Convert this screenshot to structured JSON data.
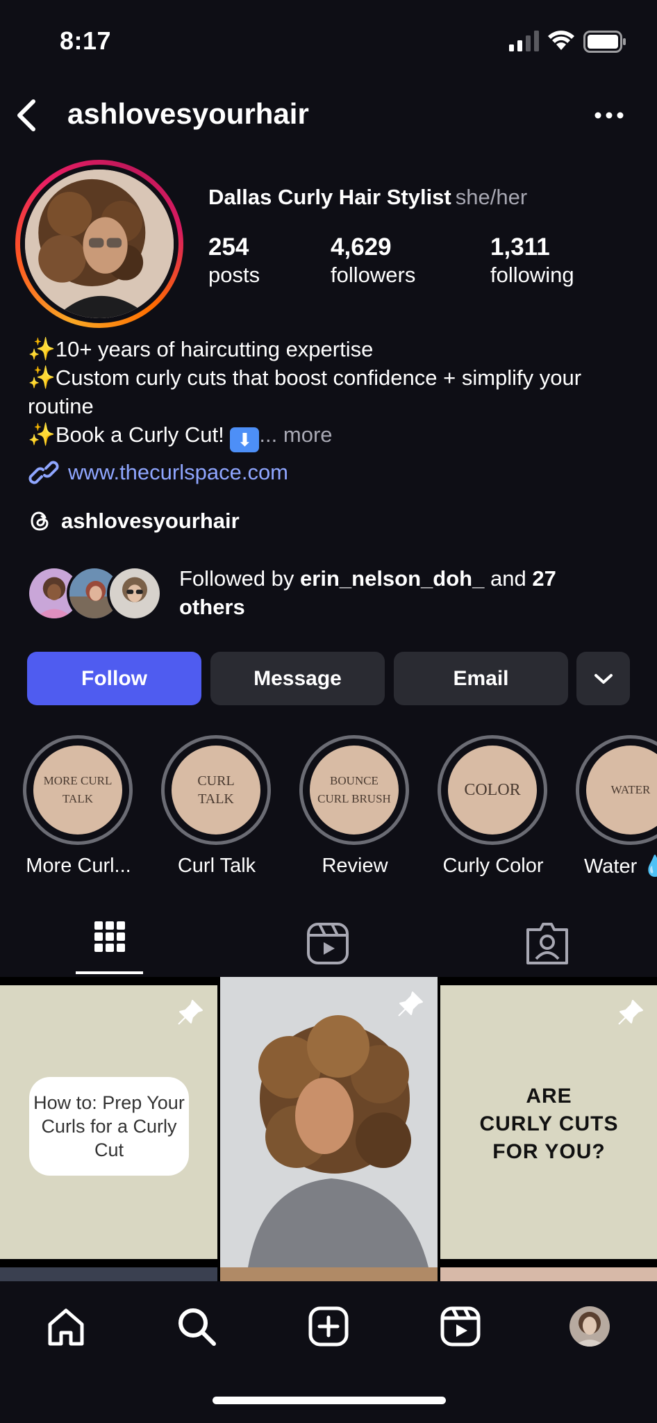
{
  "status_bar": {
    "time": "8:17"
  },
  "header": {
    "username": "ashlovesyourhair"
  },
  "profile": {
    "display_name": "Dallas Curly Hair Stylist",
    "pronouns": "she/her",
    "stats": {
      "posts": {
        "value": "254",
        "label": "posts"
      },
      "followers": {
        "value": "4,629",
        "label": "followers"
      },
      "following": {
        "value": "1,311",
        "label": "following"
      }
    },
    "bio": {
      "line1": "10+ years of haircutting expertise",
      "line2": "Custom curly cuts that boost confidence + simplify your routine",
      "line3": "Book a Curly Cut!",
      "ellipsis": "...",
      "more": "more"
    },
    "website": "www.thecurlspace.com",
    "threads_handle": "ashlovesyourhair",
    "followed_by": {
      "prefix": "Followed by",
      "user": "erin_nelson_doh_",
      "middle": "and",
      "count": "27 others"
    }
  },
  "actions": {
    "follow": "Follow",
    "message": "Message",
    "email": "Email"
  },
  "highlights": [
    {
      "cover": "MORE CURL TALK",
      "label": "More Curl..."
    },
    {
      "cover": "CURL TALK",
      "label": "Curl Talk"
    },
    {
      "cover": "BOUNCE CURL BRUSH",
      "label": "Review"
    },
    {
      "cover": "COLOR",
      "label": "Curly Color"
    },
    {
      "cover": "WATER",
      "label": "Water 💧"
    }
  ],
  "posts": {
    "p1": {
      "text": "How to: Prep Your Curls for a Curly Cut"
    },
    "p3": {
      "line1": "ARE",
      "line2": "CURLY CUTS",
      "line3": "FOR YOU?"
    }
  },
  "colors": {
    "background": "#0e0e15",
    "follow_button": "#4f5cf0",
    "secondary_button": "#2a2b32",
    "link": "#8fa6ff",
    "muted_text": "#a8a8b3"
  },
  "icons": {
    "back": "chevron-left-icon",
    "more": "ellipsis-icon",
    "link": "link-icon",
    "threads": "threads-icon",
    "dropdown": "chevron-down-icon",
    "tabs": [
      "grid-icon",
      "reels-icon",
      "tagged-icon"
    ],
    "nav": [
      "home-icon",
      "search-icon",
      "create-icon",
      "reels-icon",
      "profile-avatar"
    ]
  }
}
